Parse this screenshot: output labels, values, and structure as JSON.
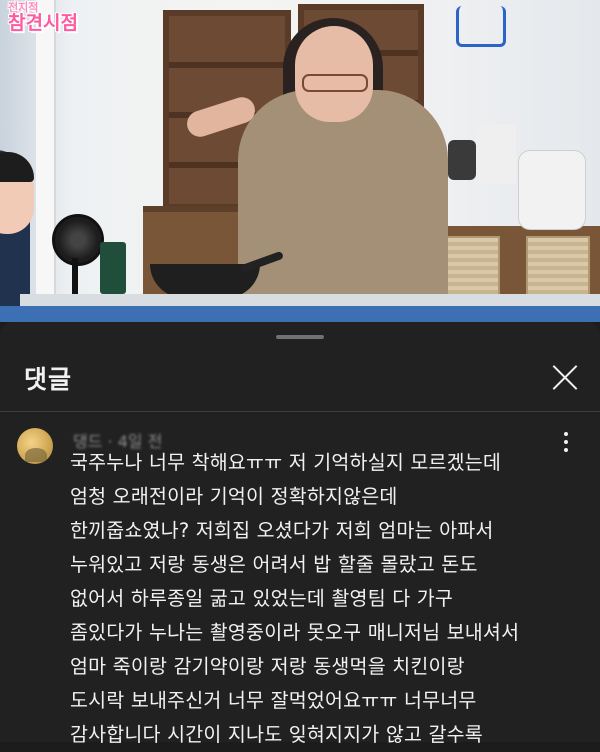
{
  "video": {
    "logo_line1": "전지적",
    "logo_line2": "참견시점"
  },
  "comments_panel": {
    "title": "댓글",
    "comment": {
      "meta": "댕드 · 4일 전",
      "lines": [
        "국주누나 너무 착해요ㅠㅠ 저 기억하실지 모르겠는데",
        "엄청 오래전이라 기억이 정확하지않은데",
        "한끼줍쇼였나? 저희집 오셨다가 저희 엄마는 아파서",
        "누워있고 저랑 동생은 어려서 밥 할줄 몰랐고 돈도",
        "없어서 하루종일 굶고 있었는데 촬영팀 다 가구",
        "좀있다가 누나는 촬영중이라 못오구 매니저님 보내셔서",
        "엄마 죽이랑 감기약이랑 저랑 동생먹을 치킨이랑",
        "도시락 보내주신거 너무 잘먹었어요ㅠㅠ 너무너무",
        "감사합니다 시간이 지나도 잊혀지지가 않고 갈수록"
      ]
    }
  }
}
